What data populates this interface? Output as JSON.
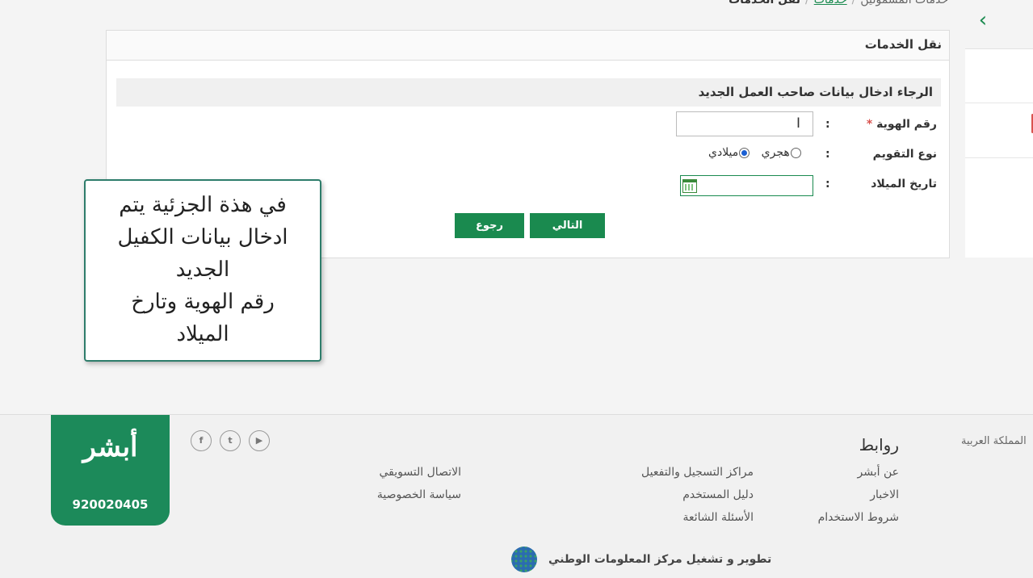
{
  "breadcrumb": {
    "items": [
      "خدمات المشمولين",
      "خدمات",
      "نقل الخدمات"
    ]
  },
  "card": {
    "title": "نقل الخدمات",
    "section_title": "الرجاء ادخال بيانات صاحب العمل الجديد",
    "fields": {
      "id_label": "رقم الهوية",
      "required_mark": "*",
      "calendar_label": "نوع التقويم",
      "birthdate_label": "تاريخ الميلاد",
      "colon": ":",
      "id_value": "",
      "birthdate_value": ""
    },
    "calendar_options": {
      "hijri": "هجري",
      "gregorian": "ميلادي",
      "selected": "ميلادي"
    },
    "buttons": {
      "next": "التالي",
      "back": "رجوع"
    }
  },
  "tooltip": {
    "lines": [
      "في هذة الجزئية يتم",
      "ادخال بيانات الكفيل",
      "الجديد",
      "رقم الهوية وتارخ",
      "الميلاد"
    ]
  },
  "footer": {
    "brand": "أبشر",
    "phone": "920020405",
    "links_title": "روابط",
    "col1": [
      "عن أبشر",
      "الاخبار",
      "شروط الاستخدام"
    ],
    "col2": [
      "مراكز التسجيل والتفعيل",
      "دليل المستخدم",
      "الأسئلة الشائعة"
    ],
    "col3": [
      "الاتصال التسويقي",
      "سياسة الخصوصية"
    ],
    "kingdom": "المملكة العربية",
    "developer": "تطوير و تشغيل مركز المعلومات الوطني",
    "social_icons": [
      "facebook-icon",
      "twitter-icon",
      "youtube-icon"
    ]
  },
  "colors": {
    "brand_green": "#1a8a4f",
    "required_red": "#d9534f",
    "tooltip_border": "#2e7d6b"
  }
}
